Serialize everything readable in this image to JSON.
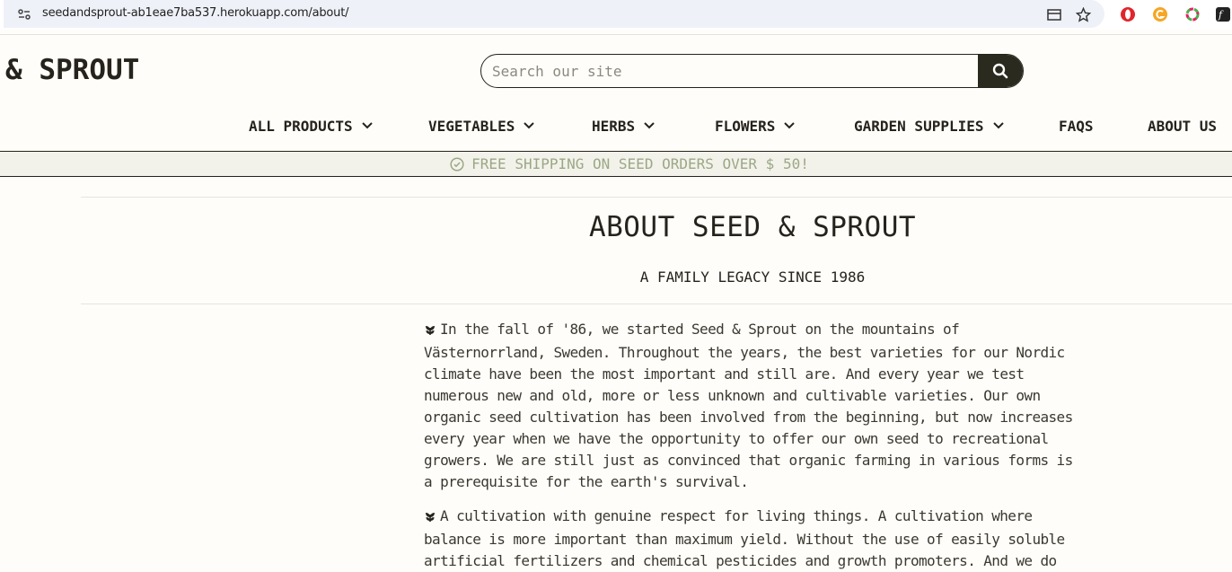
{
  "browser": {
    "url": "seedandsprout-ab1eae7ba537.herokuapp.com/about/",
    "icons": [
      "site-info-icon",
      "card-icon",
      "star-icon",
      "opera-icon",
      "grammarly-icon",
      "colorful-extension-icon",
      "fonts-extension-icon"
    ]
  },
  "header": {
    "logo": "& SPROUT",
    "search": {
      "placeholder": "Search our site",
      "button_icon": "search-icon"
    }
  },
  "nav": {
    "items": [
      {
        "label": "ALL PRODUCTS",
        "dropdown": true
      },
      {
        "label": "VEGETABLES",
        "dropdown": true
      },
      {
        "label": "HERBS",
        "dropdown": true
      },
      {
        "label": "FLOWERS",
        "dropdown": true
      },
      {
        "label": "GARDEN SUPPLIES",
        "dropdown": true
      },
      {
        "label": "FAQS",
        "dropdown": false
      },
      {
        "label": "ABOUT US",
        "dropdown": false
      }
    ]
  },
  "banner": {
    "text": "FREE SHIPPING ON SEED ORDERS OVER $ 50!",
    "icon": "check-circle-icon"
  },
  "main": {
    "title": "ABOUT SEED & SPROUT",
    "subtitle": "A FAMILY LEGACY SINCE 1986",
    "paragraphs": [
      "In the fall of '86, we started Seed & Sprout on the mountains of Västernorrland, Sweden. Throughout the years, the best varieties for our Nordic climate have been the most important and still are. And every year we test numerous new and old, more or less unknown and cultivable varieties. Our own organic seed cultivation has been involved from the beginning, but now increases every year when we have the opportunity to offer our own seed to recreational growers. We are still just as convinced that organic farming in various forms is a prerequisite for the earth's survival.",
      "A cultivation with genuine respect for living things. A cultivation where balance is more important than maximum yield. Without the use of easily soluble artificial fertilizers and chemical pesticides and growth promoters. And we do"
    ]
  },
  "colors": {
    "background": "#fefdf9",
    "text": "#26231c",
    "banner_bg": "#f3f2ea",
    "banner_text": "#9aa886",
    "search_button": "#2b2a1f"
  }
}
